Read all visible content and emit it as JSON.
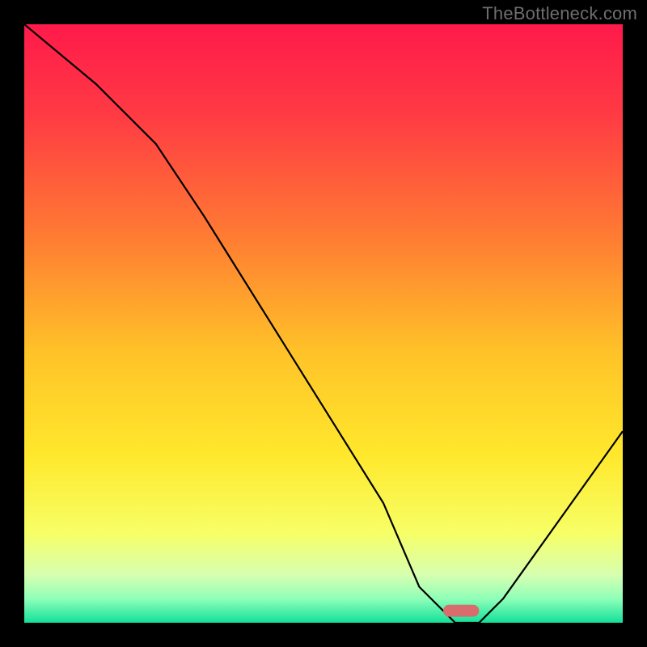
{
  "watermark": "TheBottleneck.com",
  "chart_data": {
    "type": "line",
    "title": "",
    "xlabel": "",
    "ylabel": "",
    "xlim": [
      0,
      100
    ],
    "ylim": [
      0,
      100
    ],
    "x": [
      0,
      12,
      22,
      30,
      40,
      50,
      60,
      66,
      72,
      76,
      80,
      100
    ],
    "values": [
      100,
      90,
      80,
      68,
      52,
      36,
      20,
      6,
      0,
      0,
      4,
      32
    ],
    "marker": {
      "x": 73,
      "y": 2,
      "w": 6,
      "h": 2
    },
    "gradient_stops": [
      {
        "offset": 0.0,
        "color": "#ff1a4a"
      },
      {
        "offset": 0.15,
        "color": "#ff3a44"
      },
      {
        "offset": 0.35,
        "color": "#ff7a33"
      },
      {
        "offset": 0.55,
        "color": "#ffc328"
      },
      {
        "offset": 0.72,
        "color": "#ffe82c"
      },
      {
        "offset": 0.85,
        "color": "#f7ff66"
      },
      {
        "offset": 0.92,
        "color": "#d7ffb0"
      },
      {
        "offset": 0.96,
        "color": "#8fffb8"
      },
      {
        "offset": 1.0,
        "color": "#12e09a"
      }
    ]
  }
}
